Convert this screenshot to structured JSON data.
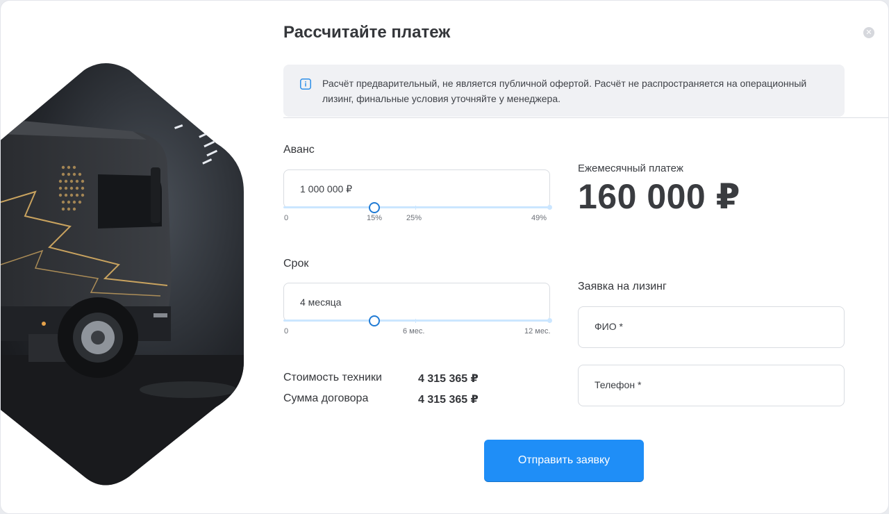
{
  "modal": {
    "title": "Рассчитайте платеж",
    "close_icon": "close-icon",
    "notice": {
      "icon": "info-icon",
      "text": "Расчёт предварительный, не является публичной офертой. Расчёт не распространяется на операционный лизинг, финальные условия уточняйте у менеджера."
    }
  },
  "advance": {
    "label": "Аванс",
    "value": "1 000 000 ₽",
    "slider_fraction": 0.34,
    "scale": {
      "min": "0",
      "mid1": "15%",
      "mid2": "25%",
      "max": "49%"
    }
  },
  "term": {
    "label": "Срок",
    "value": "4 месяца",
    "slider_fraction": 0.34,
    "scale": {
      "min": "0",
      "mid": "6 мес.",
      "max": "12 мес."
    }
  },
  "summary": {
    "equipment_cost_label": "Стоимость техники",
    "equipment_cost_value": "4 315 365 ₽",
    "contract_sum_label": "Сумма договора",
    "contract_sum_value": "4 315 365 ₽"
  },
  "payment": {
    "label": "Ежемесячный платеж",
    "value": "160 000 ₽"
  },
  "application": {
    "title": "Заявка на лизинг",
    "name_placeholder": "ФИО *",
    "phone_placeholder": "Телефон *",
    "submit_label": "Отправить заявку"
  },
  "colors": {
    "accent": "#1f8ef7",
    "slider_track": "#cbe6ff",
    "notice_bg": "#f0f1f4"
  }
}
